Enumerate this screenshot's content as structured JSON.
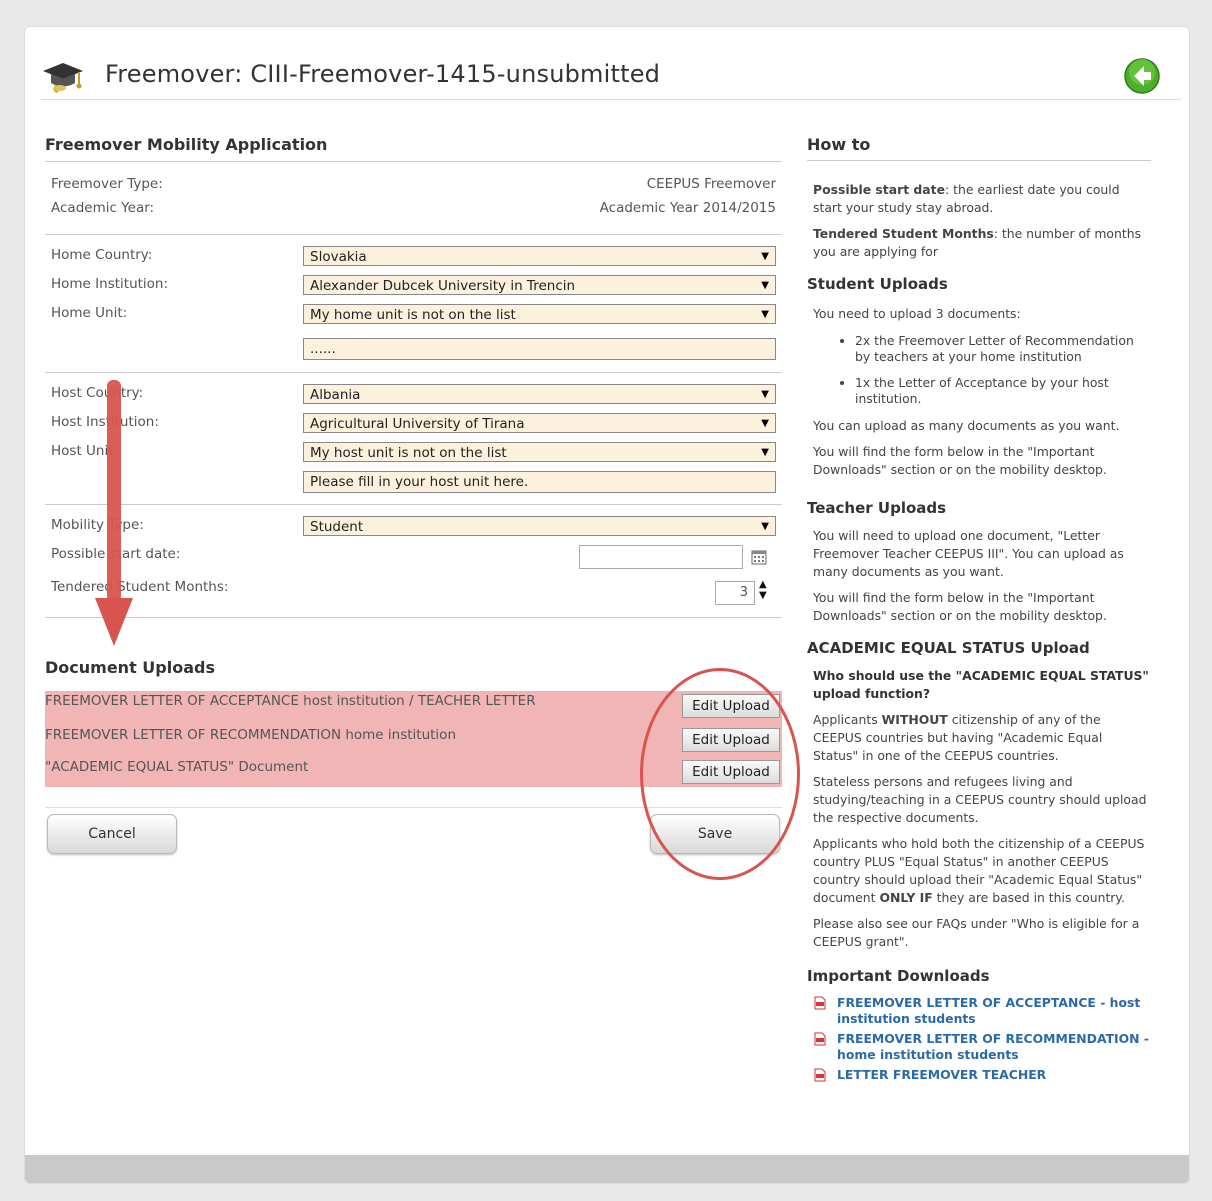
{
  "header": {
    "title": "Freemover: CIII-Freemover-1415-unsubmitted"
  },
  "form": {
    "section_title": "Freemover Mobility Application",
    "freemover_type_label": "Freemover Type:",
    "freemover_type_value": "CEEPUS Freemover",
    "academic_year_label": "Academic Year:",
    "academic_year_value": "Academic Year 2014/2015",
    "home_country_label": "Home Country:",
    "home_country_value": "Slovakia",
    "home_institution_label": "Home Institution:",
    "home_institution_value": "Alexander Dubcek University in Trencin",
    "home_unit_label": "Home Unit:",
    "home_unit_value": "My home unit is not on the list",
    "home_unit_text": "......",
    "host_country_label": "Host Country:",
    "host_country_value": "Albania",
    "host_institution_label": "Host Institution:",
    "host_institution_value": "Agricultural University of Tirana",
    "host_unit_label": "Host Unit:",
    "host_unit_value": "My host unit is not on the list",
    "host_unit_text": "Please fill in your host unit here.",
    "mobility_type_label": "Mobility Type:",
    "mobility_type_value": "Student",
    "start_date_label": "Possible start date:",
    "start_date_value": "",
    "months_label": "Tendered Student Months:",
    "months_value": "3"
  },
  "uploads": {
    "section_title": "Document Uploads",
    "items": [
      {
        "label": "FREEMOVER LETTER OF ACCEPTANCE host institution / TEACHER LETTER",
        "button": "Edit Upload"
      },
      {
        "label": "FREEMOVER LETTER OF RECOMMENDATION home institution",
        "button": "Edit Upload"
      },
      {
        "label": "\"ACADEMIC EQUAL STATUS\" Document",
        "button": "Edit Upload"
      }
    ],
    "highlight_color": "#f2b5b5"
  },
  "actions": {
    "cancel": "Cancel",
    "save": "Save"
  },
  "howto": {
    "title": "How to",
    "start_date_term": "Possible start date",
    "start_date_desc": ": the earliest date you could start your study stay abroad.",
    "months_term": "Tendered Student Months",
    "months_desc": ": the number of months you are applying for",
    "student_title": "Student Uploads",
    "student_intro": "You need to upload 3 documents:",
    "student_bullets": [
      "2x the Freemover Letter of Recommendation by teachers at your home institution",
      "1x the Letter of Acceptance by your host institution."
    ],
    "student_p1": "You can upload as many documents as you want.",
    "student_p2": "You will find the form below in the \"Important Downloads\" section or on the mobility desktop.",
    "teacher_title": "Teacher Uploads",
    "teacher_p1": "You will need to upload one document, \"Letter Freemover Teacher CEEPUS III\". You can upload as many documents as you want.",
    "teacher_p2": "You will find the form below in the \"Important Downloads\" section or on the mobility desktop.",
    "aes_title": "ACADEMIC EQUAL STATUS Upload",
    "aes_question": "Who should use the \"ACADEMIC EQUAL STATUS\" upload function?",
    "aes_p1_a": "Applicants ",
    "aes_p1_b": "WITHOUT",
    "aes_p1_c": " citizenship of any of the CEEPUS countries but having \"Academic Equal Status\" in one of the CEEPUS countries.",
    "aes_p2": "Stateless persons and refugees living and studying/teaching in a CEEPUS country should upload the respective documents.",
    "aes_p3_a": "Applicants who hold both the citizenship of a CEEPUS country PLUS \"Equal Status\" in another CEEPUS country should upload their \"Academic Equal Status\" document ",
    "aes_p3_b": "ONLY IF",
    "aes_p3_c": " they are based in this country.",
    "aes_p4": "Please also see our FAQs under \"Who is eligible for a CEEPUS grant\".",
    "downloads_title": "Important Downloads",
    "downloads": [
      "FREEMOVER LETTER OF ACCEPTANCE - host institution students",
      "FREEMOVER LETTER OF RECOMMENDATION - home institution students",
      "LETTER FREEMOVER TEACHER"
    ]
  },
  "colors": {
    "link": "#2b6aa8",
    "annotation": "#d9534f",
    "input_bg": "#fbf1dc"
  }
}
